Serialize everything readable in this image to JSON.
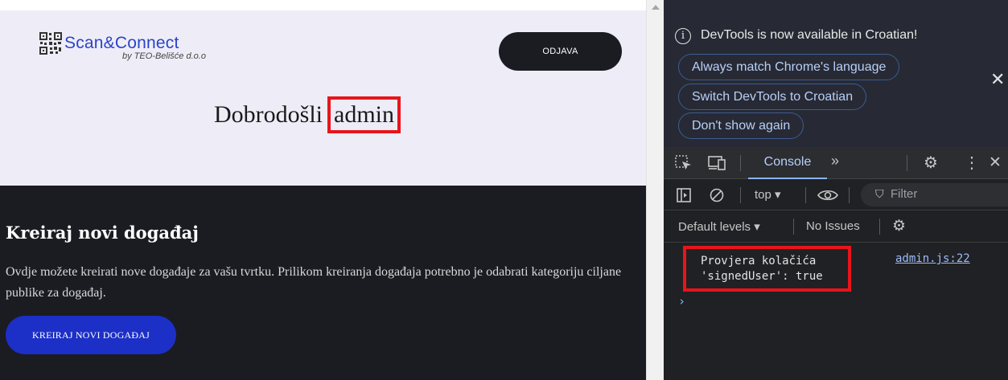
{
  "page": {
    "logo": {
      "brand": "Scan&Connect",
      "subtitle": "by TEO-Belišće d.o.o"
    },
    "logout_label": "ODJAVA",
    "welcome": {
      "greeting": "Dobrodošli",
      "username": "admin"
    },
    "section": {
      "title": "Kreiraj novi događaj",
      "description": "Ovdje možete kreirati nove događaje za vašu tvrtku. Prilikom kreiranja događaja potrebno je odabrati kategoriju ciljane publike za događaj.",
      "button_label": "KREIRAJ NOVI DOGAĐAJ"
    },
    "colors": {
      "hero_bg": "#eeedf7",
      "dark_bg": "#1b1b22",
      "primary_button": "#1c2fc6",
      "highlight": "#e8141c"
    }
  },
  "devtools": {
    "notice": {
      "text": "DevTools is now available in Croatian!",
      "buttons": [
        "Always match Chrome's language",
        "Switch DevTools to Croatian",
        "Don't show again"
      ]
    },
    "tabs": {
      "active": "Console",
      "more": "»"
    },
    "toolbar": {
      "context": "top ▾",
      "filter_placeholder": "Filter"
    },
    "levels": {
      "label": "Default levels ▾",
      "issues": "No Issues"
    },
    "console": {
      "message": "Provjera kolačića\n'signedUser': true",
      "source": "admin.js:22",
      "prompt": "›"
    },
    "icons": [
      "info-icon",
      "close-icon",
      "inspect-icon",
      "device-icon",
      "settings-icon",
      "kebab-icon",
      "sidebar-icon",
      "clear-icon",
      "eye-icon",
      "filter-icon"
    ]
  }
}
